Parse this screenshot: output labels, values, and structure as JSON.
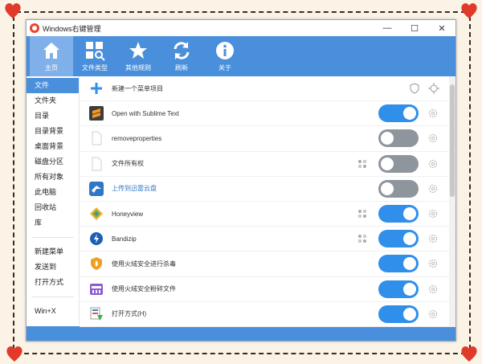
{
  "window": {
    "title": "Windows右键管理"
  },
  "toolbar": {
    "items": [
      {
        "label": "主页",
        "icon": "home-icon"
      },
      {
        "label": "文件类型",
        "icon": "file-types-icon"
      },
      {
        "label": "其他规则",
        "icon": "star-icon"
      },
      {
        "label": "刷新",
        "icon": "refresh-icon"
      },
      {
        "label": "关于",
        "icon": "info-icon"
      }
    ]
  },
  "sidebar": {
    "group1": [
      "文件",
      "文件夹",
      "目录",
      "目录背景",
      "桌面背景",
      "磁盘分区",
      "所有对象",
      "此电脑",
      "回收站",
      "库"
    ],
    "group2": [
      "新建菜单",
      "发送到",
      "打开方式"
    ],
    "group3": [
      "Win+X"
    ]
  },
  "rows": {
    "new_item": "新建一个菜单项目",
    "items": [
      {
        "label": "Open with Sublime Text",
        "state": "on"
      },
      {
        "label": "removeproperties",
        "state": "off"
      },
      {
        "label": "文件所有权",
        "state": "off"
      },
      {
        "label": "上传到迅雷云盘",
        "state": "off"
      },
      {
        "label": "Honeyview",
        "state": "on"
      },
      {
        "label": "Bandizip",
        "state": "on"
      },
      {
        "label": "使用火绒安全进行杀毒",
        "state": "on"
      },
      {
        "label": "使用火绒安全粉碎文件",
        "state": "on"
      },
      {
        "label": "打开方式(H)",
        "state": "on"
      }
    ]
  },
  "colors": {
    "accent": "#4a8fdb",
    "toggle_on": "#2f8fea",
    "toggle_off": "#8f959c"
  }
}
